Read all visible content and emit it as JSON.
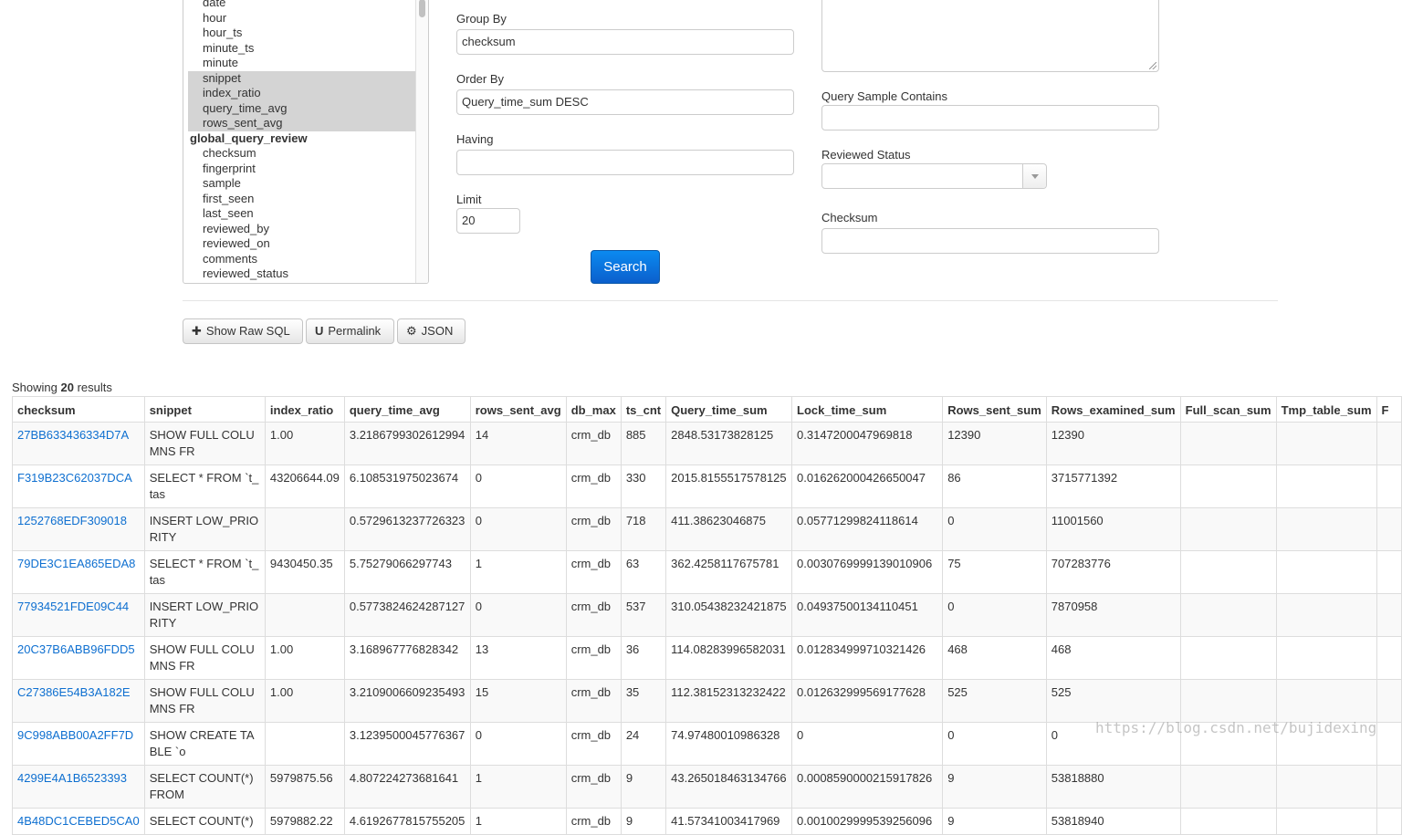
{
  "columns_list": {
    "options": [
      {
        "label": "date",
        "selected": false,
        "group": false
      },
      {
        "label": "hour",
        "selected": false,
        "group": false
      },
      {
        "label": "hour_ts",
        "selected": false,
        "group": false
      },
      {
        "label": "minute_ts",
        "selected": false,
        "group": false
      },
      {
        "label": "minute",
        "selected": false,
        "group": false
      },
      {
        "label": "snippet",
        "selected": true,
        "group": false
      },
      {
        "label": "index_ratio",
        "selected": true,
        "group": false
      },
      {
        "label": "query_time_avg",
        "selected": true,
        "group": false
      },
      {
        "label": "rows_sent_avg",
        "selected": true,
        "group": false
      },
      {
        "label": "global_query_review",
        "selected": false,
        "group": true
      },
      {
        "label": "checksum",
        "selected": false,
        "group": false
      },
      {
        "label": "fingerprint",
        "selected": false,
        "group": false
      },
      {
        "label": "sample",
        "selected": false,
        "group": false
      },
      {
        "label": "first_seen",
        "selected": false,
        "group": false
      },
      {
        "label": "last_seen",
        "selected": false,
        "group": false
      },
      {
        "label": "reviewed_by",
        "selected": false,
        "group": false
      },
      {
        "label": "reviewed_on",
        "selected": false,
        "group": false
      },
      {
        "label": "comments",
        "selected": false,
        "group": false
      },
      {
        "label": "reviewed_status",
        "selected": false,
        "group": false
      }
    ]
  },
  "form": {
    "group_by_label": "Group By",
    "group_by_value": "checksum",
    "order_by_label": "Order By",
    "order_by_value": "Query_time_sum DESC",
    "having_label": "Having",
    "having_value": "",
    "limit_label": "Limit",
    "limit_value": "20",
    "search_label": "Search",
    "query_sample_label": "Query Sample Contains",
    "query_sample_value": "",
    "reviewed_status_label": "Reviewed Status",
    "reviewed_status_value": "",
    "checksum_label": "Checksum",
    "checksum_value": ""
  },
  "toolbar": {
    "show_raw_sql": "Show Raw SQL",
    "permalink": "Permalink",
    "json": "JSON"
  },
  "results": {
    "showing_prefix": "Showing",
    "count": "20",
    "showing_suffix": "results",
    "headers": [
      "checksum",
      "snippet",
      "index_ratio",
      "query_time_avg",
      "rows_sent_avg",
      "db_max",
      "ts_cnt",
      "Query_time_sum",
      "Lock_time_sum",
      "Rows_sent_sum",
      "Rows_examined_sum",
      "Full_scan_sum",
      "Tmp_table_sum",
      "F"
    ],
    "rows": [
      [
        "27BB633436334D7A",
        "SHOW FULL COLUMNS FR",
        "1.00",
        "3.2186799302612994",
        "14",
        "crm_db",
        "885",
        "2848.53173828125",
        "0.3147200047969818",
        "12390",
        "12390",
        "",
        "",
        ""
      ],
      [
        "F319B23C62037DCA",
        "SELECT * FROM `t_tas",
        "43206644.09",
        "6.108531975023674",
        "0",
        "crm_db",
        "330",
        "2015.8155517578125",
        "0.016262000426650047",
        "86",
        "3715771392",
        "",
        "",
        ""
      ],
      [
        "1252768EDF309018",
        "INSERT LOW_PRIORITY",
        "",
        "0.5729613237726323",
        "0",
        "crm_db",
        "718",
        "411.38623046875",
        "0.05771299824118614",
        "0",
        "11001560",
        "",
        "",
        ""
      ],
      [
        "79DE3C1EA865EDA8",
        "SELECT * FROM `t_tas",
        "9430450.35",
        "5.75279066297743",
        "1",
        "crm_db",
        "63",
        "362.4258117675781",
        "0.0030769999139010906",
        "75",
        "707283776",
        "",
        "",
        ""
      ],
      [
        "77934521FDE09C44",
        "INSERT LOW_PRIORITY",
        "",
        "0.5773824624287127",
        "0",
        "crm_db",
        "537",
        "310.05438232421875",
        "0.04937500134110451",
        "0",
        "7870958",
        "",
        "",
        ""
      ],
      [
        "20C37B6ABB96FDD5",
        "SHOW FULL COLUMNS FR",
        "1.00",
        "3.168967776828342",
        "13",
        "crm_db",
        "36",
        "114.08283996582031",
        "0.012834999710321426",
        "468",
        "468",
        "",
        "",
        ""
      ],
      [
        "C27386E54B3A182E",
        "SHOW FULL COLUMNS FR",
        "1.00",
        "3.2109006609235493",
        "15",
        "crm_db",
        "35",
        "112.38152313232422",
        "0.012632999569177628",
        "525",
        "525",
        "",
        "",
        ""
      ],
      [
        "9C998ABB00A2FF7D",
        "SHOW CREATE TABLE `o",
        "",
        "3.1239500045776367",
        "0",
        "crm_db",
        "24",
        "74.97480010986328",
        "0",
        "0",
        "0",
        "",
        "",
        ""
      ],
      [
        "4299E4A1B6523393",
        "SELECT COUNT(*) FROM",
        "5979875.56",
        "4.807224273681641",
        "1",
        "crm_db",
        "9",
        "43.265018463134766",
        "0.0008590000215917826",
        "9",
        "53818880",
        "",
        "",
        ""
      ],
      [
        "4B48DC1CEBED5CA0",
        "SELECT COUNT(*)",
        "5979882.22",
        "4.6192677815755205",
        "1",
        "crm_db",
        "9",
        "41.57341003417969",
        "0.0010029999539256096",
        "9",
        "53818940",
        "",
        "",
        ""
      ]
    ]
  },
  "watermark": "https://blog.csdn.net/bujidexing"
}
